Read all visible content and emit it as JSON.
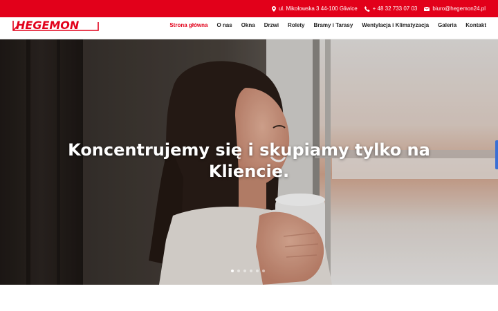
{
  "topbar": {
    "address": "ul. Mikołowska 3 44-100 Gliwice",
    "phone": "+ 48 32 733 07 03",
    "email": "biuro@hegemon24.pl",
    "background_color": "#e2001a"
  },
  "brand": {
    "logo_text": "HEGEMON",
    "color": "#e2001a"
  },
  "nav": {
    "items": [
      {
        "label": "Strona główna",
        "active": true
      },
      {
        "label": "O nas"
      },
      {
        "label": "Okna"
      },
      {
        "label": "Drzwi"
      },
      {
        "label": "Rolety"
      },
      {
        "label": "Bramy i Tarasy"
      },
      {
        "label": "Wentylacja i Klimatyzacja"
      },
      {
        "label": "Galeria"
      },
      {
        "label": "Kontakt"
      }
    ]
  },
  "hero": {
    "title_line1": "Koncentrujemy się i skupiamy tylko na",
    "title_line2": "Kliencie.",
    "slider": {
      "total_slides": 6,
      "active_slide": 1
    }
  },
  "icons": [
    "map-pin-icon",
    "phone-icon",
    "envelope-icon"
  ]
}
